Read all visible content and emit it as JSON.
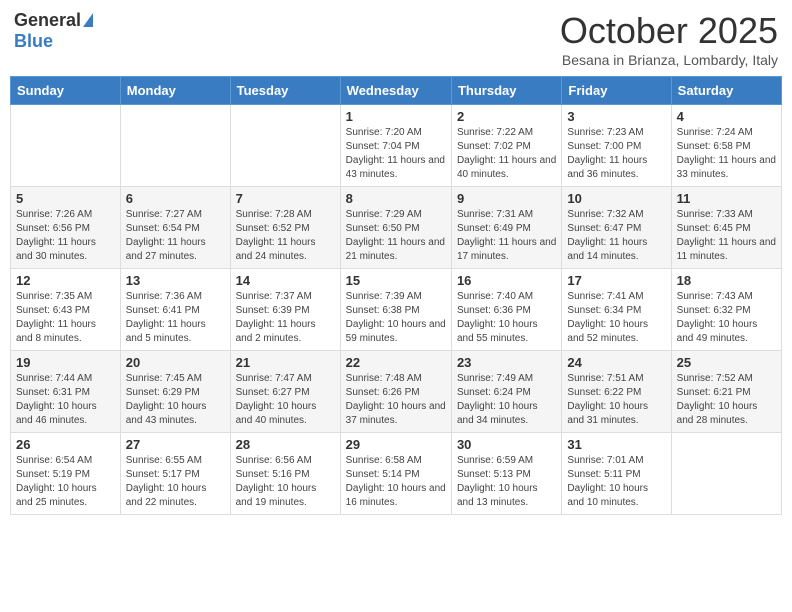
{
  "header": {
    "logo": {
      "general": "General",
      "blue": "Blue"
    },
    "title": "October 2025",
    "subtitle": "Besana in Brianza, Lombardy, Italy"
  },
  "days_of_week": [
    "Sunday",
    "Monday",
    "Tuesday",
    "Wednesday",
    "Thursday",
    "Friday",
    "Saturday"
  ],
  "weeks": [
    {
      "days": [
        {
          "number": "",
          "info": ""
        },
        {
          "number": "",
          "info": ""
        },
        {
          "number": "",
          "info": ""
        },
        {
          "number": "1",
          "info": "Sunrise: 7:20 AM\nSunset: 7:04 PM\nDaylight: 11 hours and 43 minutes."
        },
        {
          "number": "2",
          "info": "Sunrise: 7:22 AM\nSunset: 7:02 PM\nDaylight: 11 hours and 40 minutes."
        },
        {
          "number": "3",
          "info": "Sunrise: 7:23 AM\nSunset: 7:00 PM\nDaylight: 11 hours and 36 minutes."
        },
        {
          "number": "4",
          "info": "Sunrise: 7:24 AM\nSunset: 6:58 PM\nDaylight: 11 hours and 33 minutes."
        }
      ]
    },
    {
      "days": [
        {
          "number": "5",
          "info": "Sunrise: 7:26 AM\nSunset: 6:56 PM\nDaylight: 11 hours and 30 minutes."
        },
        {
          "number": "6",
          "info": "Sunrise: 7:27 AM\nSunset: 6:54 PM\nDaylight: 11 hours and 27 minutes."
        },
        {
          "number": "7",
          "info": "Sunrise: 7:28 AM\nSunset: 6:52 PM\nDaylight: 11 hours and 24 minutes."
        },
        {
          "number": "8",
          "info": "Sunrise: 7:29 AM\nSunset: 6:50 PM\nDaylight: 11 hours and 21 minutes."
        },
        {
          "number": "9",
          "info": "Sunrise: 7:31 AM\nSunset: 6:49 PM\nDaylight: 11 hours and 17 minutes."
        },
        {
          "number": "10",
          "info": "Sunrise: 7:32 AM\nSunset: 6:47 PM\nDaylight: 11 hours and 14 minutes."
        },
        {
          "number": "11",
          "info": "Sunrise: 7:33 AM\nSunset: 6:45 PM\nDaylight: 11 hours and 11 minutes."
        }
      ]
    },
    {
      "days": [
        {
          "number": "12",
          "info": "Sunrise: 7:35 AM\nSunset: 6:43 PM\nDaylight: 11 hours and 8 minutes."
        },
        {
          "number": "13",
          "info": "Sunrise: 7:36 AM\nSunset: 6:41 PM\nDaylight: 11 hours and 5 minutes."
        },
        {
          "number": "14",
          "info": "Sunrise: 7:37 AM\nSunset: 6:39 PM\nDaylight: 11 hours and 2 minutes."
        },
        {
          "number": "15",
          "info": "Sunrise: 7:39 AM\nSunset: 6:38 PM\nDaylight: 10 hours and 59 minutes."
        },
        {
          "number": "16",
          "info": "Sunrise: 7:40 AM\nSunset: 6:36 PM\nDaylight: 10 hours and 55 minutes."
        },
        {
          "number": "17",
          "info": "Sunrise: 7:41 AM\nSunset: 6:34 PM\nDaylight: 10 hours and 52 minutes."
        },
        {
          "number": "18",
          "info": "Sunrise: 7:43 AM\nSunset: 6:32 PM\nDaylight: 10 hours and 49 minutes."
        }
      ]
    },
    {
      "days": [
        {
          "number": "19",
          "info": "Sunrise: 7:44 AM\nSunset: 6:31 PM\nDaylight: 10 hours and 46 minutes."
        },
        {
          "number": "20",
          "info": "Sunrise: 7:45 AM\nSunset: 6:29 PM\nDaylight: 10 hours and 43 minutes."
        },
        {
          "number": "21",
          "info": "Sunrise: 7:47 AM\nSunset: 6:27 PM\nDaylight: 10 hours and 40 minutes."
        },
        {
          "number": "22",
          "info": "Sunrise: 7:48 AM\nSunset: 6:26 PM\nDaylight: 10 hours and 37 minutes."
        },
        {
          "number": "23",
          "info": "Sunrise: 7:49 AM\nSunset: 6:24 PM\nDaylight: 10 hours and 34 minutes."
        },
        {
          "number": "24",
          "info": "Sunrise: 7:51 AM\nSunset: 6:22 PM\nDaylight: 10 hours and 31 minutes."
        },
        {
          "number": "25",
          "info": "Sunrise: 7:52 AM\nSunset: 6:21 PM\nDaylight: 10 hours and 28 minutes."
        }
      ]
    },
    {
      "days": [
        {
          "number": "26",
          "info": "Sunrise: 6:54 AM\nSunset: 5:19 PM\nDaylight: 10 hours and 25 minutes."
        },
        {
          "number": "27",
          "info": "Sunrise: 6:55 AM\nSunset: 5:17 PM\nDaylight: 10 hours and 22 minutes."
        },
        {
          "number": "28",
          "info": "Sunrise: 6:56 AM\nSunset: 5:16 PM\nDaylight: 10 hours and 19 minutes."
        },
        {
          "number": "29",
          "info": "Sunrise: 6:58 AM\nSunset: 5:14 PM\nDaylight: 10 hours and 16 minutes."
        },
        {
          "number": "30",
          "info": "Sunrise: 6:59 AM\nSunset: 5:13 PM\nDaylight: 10 hours and 13 minutes."
        },
        {
          "number": "31",
          "info": "Sunrise: 7:01 AM\nSunset: 5:11 PM\nDaylight: 10 hours and 10 minutes."
        },
        {
          "number": "",
          "info": ""
        }
      ]
    }
  ]
}
